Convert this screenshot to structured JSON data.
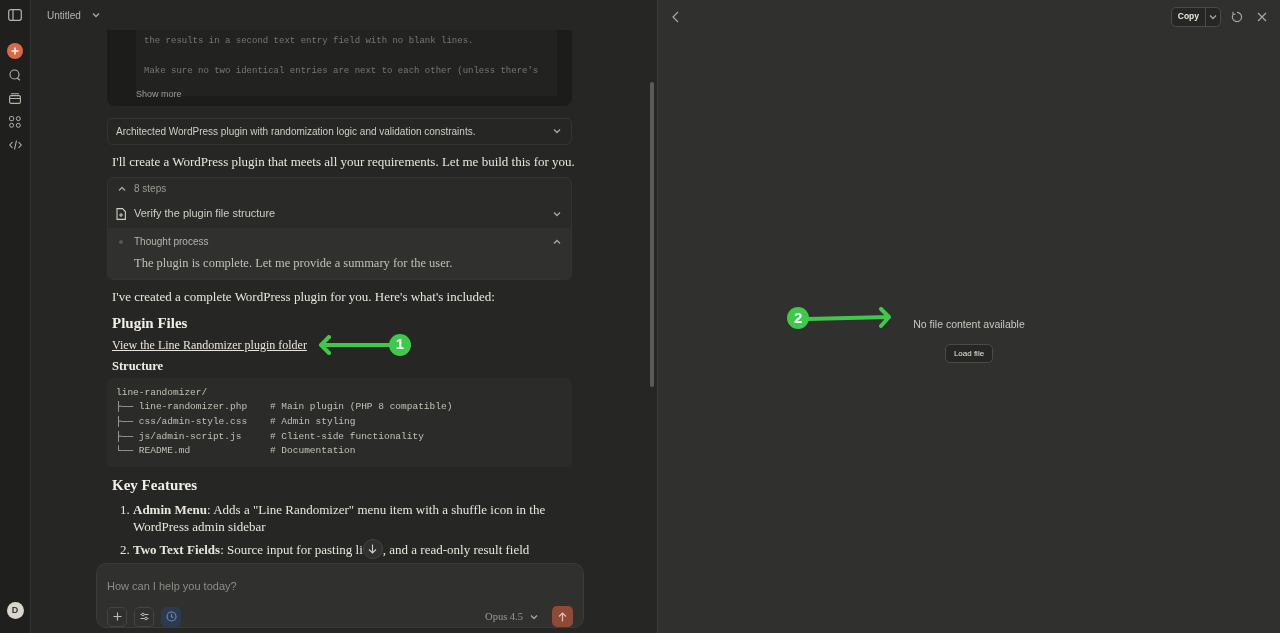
{
  "header": {
    "title": "Untitled"
  },
  "sidebar": {
    "avatar": "D"
  },
  "prompt_card": {
    "lines": [
      "the results in a second text entry field with no blank lines.",
      "Make sure no two identical entries are next to each other (unless there's"
    ],
    "show_more": "Show more"
  },
  "thinking_summary": {
    "text": "Architected WordPress plugin with randomization logic and validation constraints.",
    "expanded": false
  },
  "intro": "I'll create a WordPress plugin that meets all your requirements. Let me build this for you.",
  "steps": {
    "label": "8 steps",
    "expanded": true,
    "items": [
      {
        "kind": "tool",
        "label": "Verify the plugin file structure",
        "expanded": false
      },
      {
        "kind": "thought",
        "label": "Thought process",
        "expanded": true,
        "detail": "The plugin is complete. Let me provide a summary for the user."
      }
    ]
  },
  "summary": "I've created a complete WordPress plugin for you. Here's what's included:",
  "plugin_files": {
    "heading": "Plugin Files",
    "link": "View the Line Randomizer plugin folder"
  },
  "structure": {
    "heading": "Structure",
    "code_lines": [
      "line-randomizer/",
      "├── line-randomizer.php    # Main plugin (PHP 8 compatible)",
      "├── css/admin-style.css    # Admin styling",
      "├── js/admin-script.js     # Client-side functionality",
      "└── README.md              # Documentation"
    ]
  },
  "key_features": {
    "heading": "Key Features",
    "items": [
      {
        "number": "1.",
        "text": "**Admin Menu**: Adds a \"Line Randomizer\" menu item with a shuffle icon in the WordPress admin sidebar"
      },
      {
        "number": "2.",
        "text": "**Two Text Fields**: Source input for pasting li",
        "text_after": ", and a read-only result field"
      }
    ]
  },
  "composer": {
    "placeholder": "How can I help you today?",
    "model": "Opus 4.5"
  },
  "artifact_panel": {
    "copy_button": "Copy",
    "message": "No file content available",
    "load_button": "Load file"
  },
  "annotations": [
    {
      "number": "1"
    },
    {
      "number": "2"
    }
  ]
}
